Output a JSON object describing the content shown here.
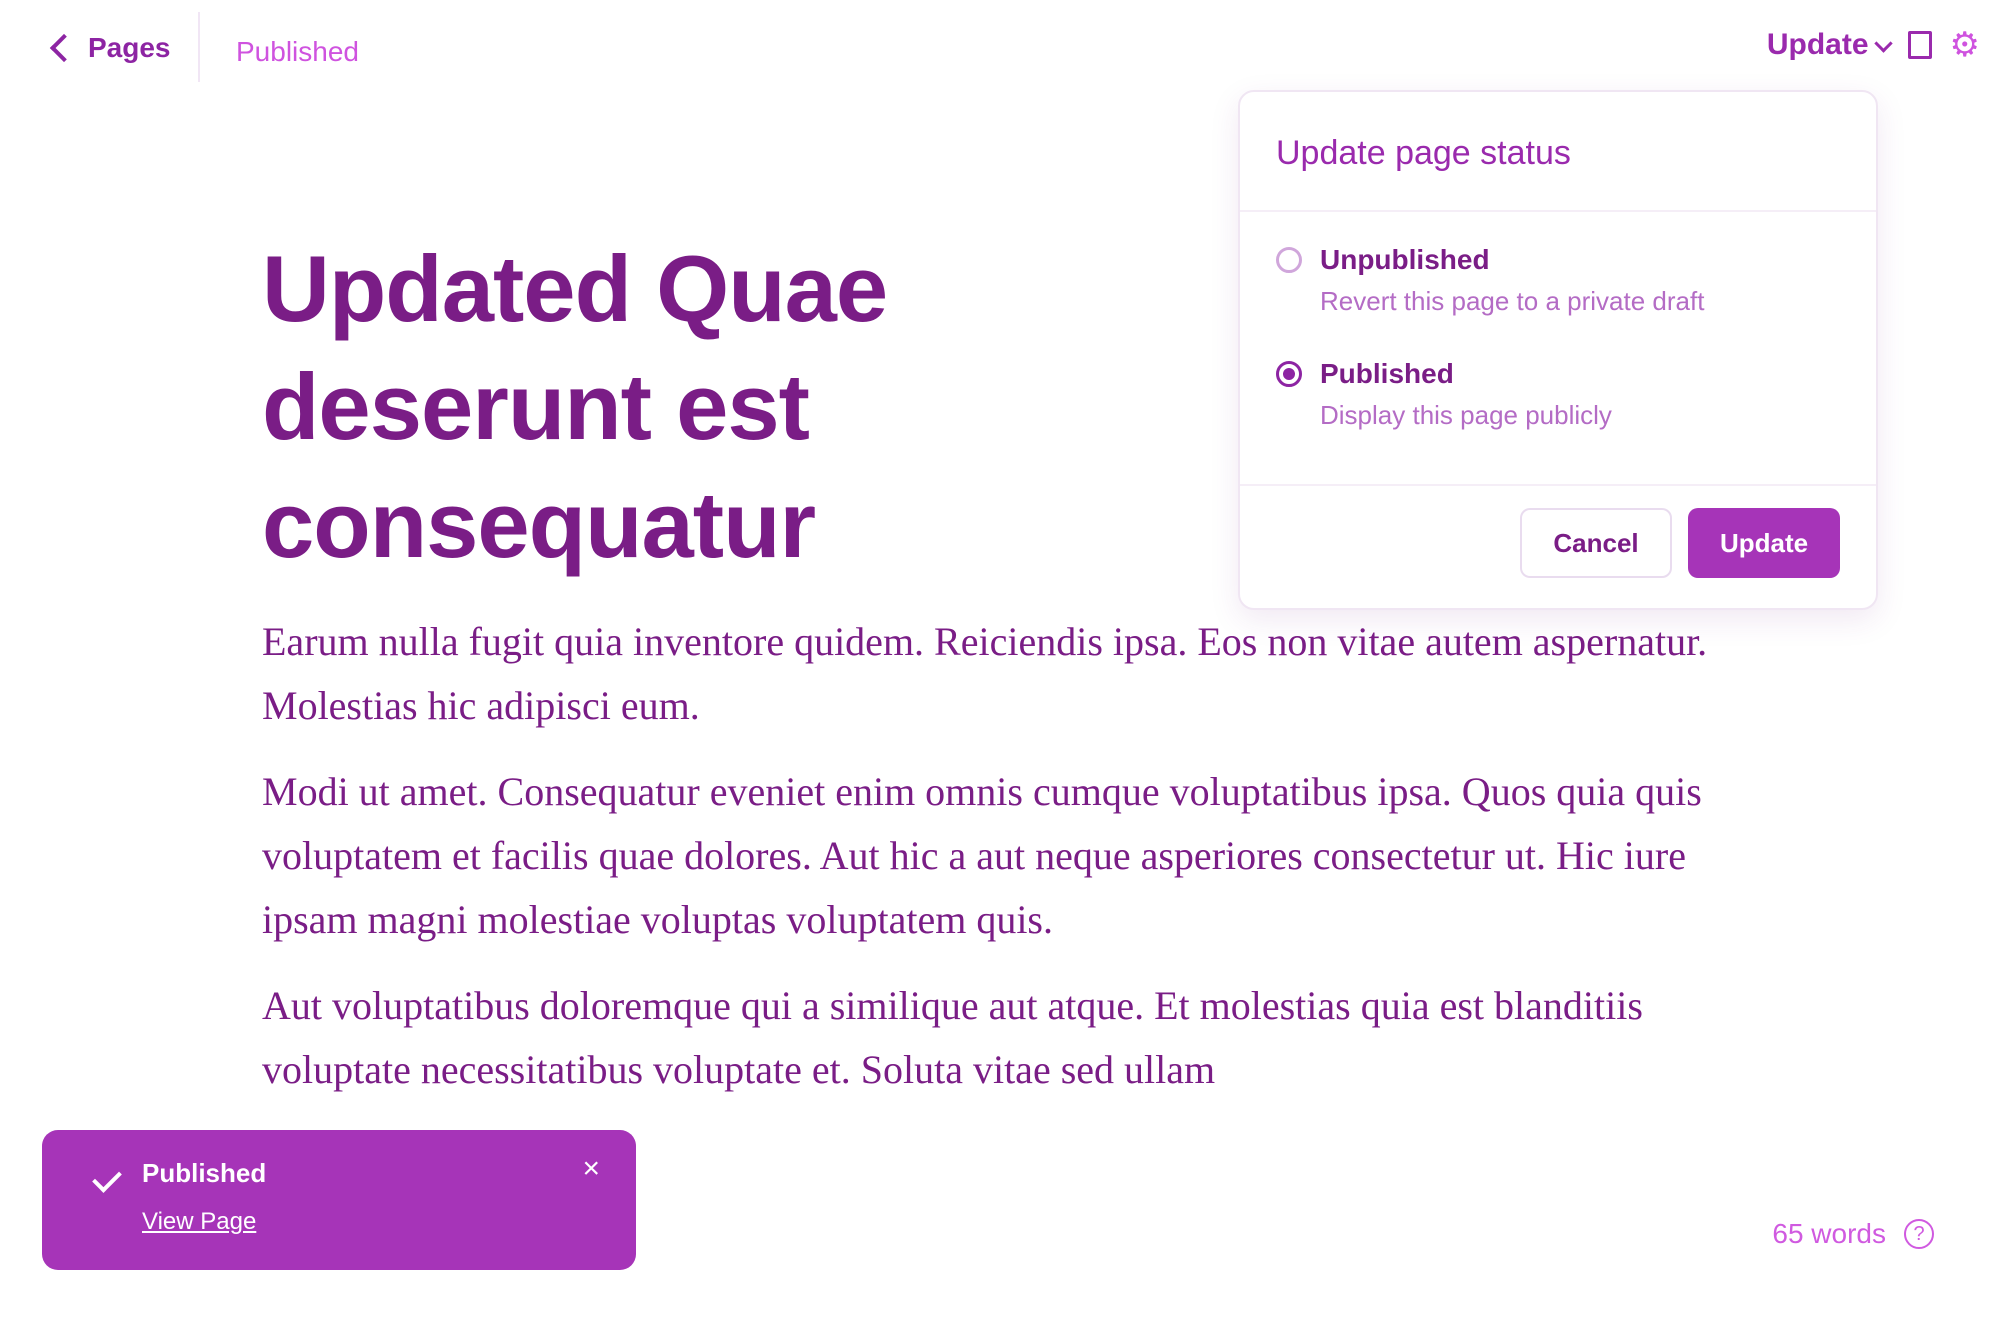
{
  "topbar": {
    "back_label": "Pages",
    "status": "Published",
    "update_label": "Update"
  },
  "editor": {
    "title": "Updated Quae deserunt est consequatur",
    "paragraphs": [
      "Earum nulla fugit quia inventore quidem. Reiciendis ipsa. Eos non vitae autem aspernatur. Molestias hic adipisci eum.",
      "Modi ut amet. Consequatur eveniet enim omnis cumque voluptatibus ipsa. Quos quia quis voluptatem et facilis quae dolores. Aut hic a aut neque asperiores consectetur ut. Hic iure ipsam magni molestiae voluptas voluptatem quis.",
      "Aut voluptatibus doloremque qui a similique aut atque. Et molestias quia est blanditiis voluptate necessitatibus voluptate et. Soluta vitae sed ullam"
    ]
  },
  "popover": {
    "title": "Update page status",
    "options": [
      {
        "label": "Unpublished",
        "description": "Revert this page to a private draft",
        "selected": false
      },
      {
        "label": "Published",
        "description": "Display this page publicly",
        "selected": true
      }
    ],
    "cancel_label": "Cancel",
    "update_label": "Update"
  },
  "toast": {
    "title": "Published",
    "link_label": "View Page",
    "close_symbol": "×"
  },
  "footer": {
    "word_count": "65 words",
    "help_symbol": "?"
  },
  "icons": {
    "back": "chevron-left-icon",
    "update_caret": "chevron-down-icon",
    "panel": "sidebar-toggle-icon",
    "settings": "gear-icon",
    "toast_check": "check-icon",
    "toast_close": "close-icon",
    "help": "help-icon"
  },
  "colors": {
    "accent": "#a634b8",
    "text": "#7a1d86",
    "muted": "#cf53df"
  }
}
